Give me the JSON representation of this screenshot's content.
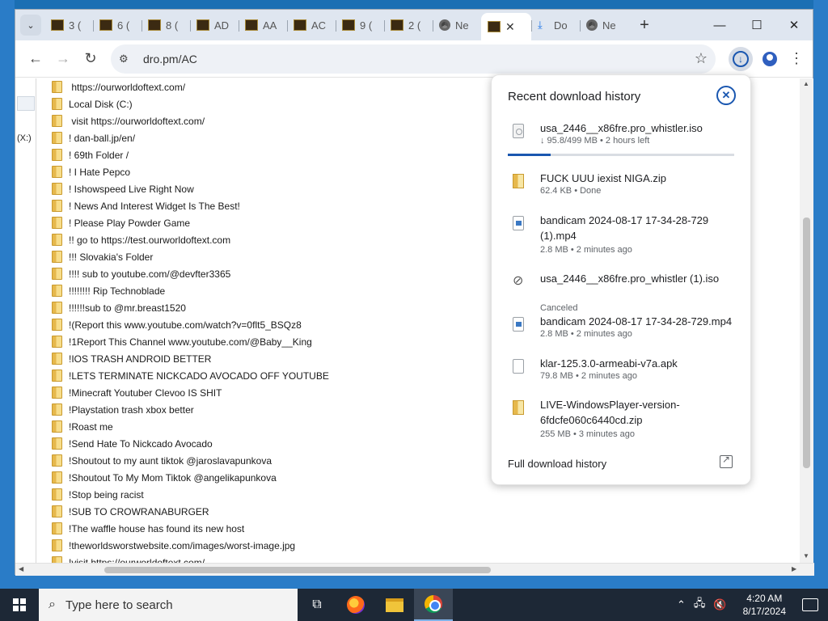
{
  "browser": {
    "tabs": [
      {
        "title": "3 (",
        "icon": "image-thumb-icon"
      },
      {
        "title": "6 (",
        "icon": "image-thumb-icon"
      },
      {
        "title": "8 (",
        "icon": "image-thumb-icon"
      },
      {
        "title": "AD",
        "icon": "image-thumb-icon"
      },
      {
        "title": "AA",
        "icon": "image-thumb-icon"
      },
      {
        "title": "AC",
        "icon": "image-thumb-icon"
      },
      {
        "title": "9 (",
        "icon": "image-thumb-icon"
      },
      {
        "title": "2 (",
        "icon": "image-thumb-icon"
      },
      {
        "title": "Ne",
        "icon": "chrome-icon"
      },
      {
        "title": "",
        "icon": "image-thumb-icon",
        "active": true
      },
      {
        "title": "Do",
        "icon": "download-icon"
      },
      {
        "title": "Ne",
        "icon": "chrome-icon"
      }
    ],
    "url": "dro.pm/AC"
  },
  "sidebar": {
    "drive_label": "(X:)"
  },
  "folders": [
    " https://ourworldoftext.com/",
    "Local Disk (C:)",
    " visit https://ourworldoftext.com/",
    "! dan-ball.jp/en/",
    "! 69th Folder /",
    "! I Hate Pepco",
    "! Ishowspeed Live Right Now",
    "! News And Interest Widget Is The Best!",
    "! Please Play Powder Game",
    "!! go to https://test.ourworldoftext.com",
    "!!! Slovakia's Folder",
    "!!!! sub to youtube.com/@devfter3365",
    "!!!!!!!! Rip Technoblade",
    "!!!!!!sub to @mr.breast1520",
    "!(Report this www.youtube.com/watch?v=0flt5_BSQz8",
    "!1Report This Channel www.youtube.com/@Baby__King",
    "!IOS TRASH ANDROID BETTER",
    "!LETS TERMINATE NICKCADO AVOCADO OFF YOUTUBE",
    "!Minecraft Youtuber Clevoo IS SHIT",
    "!Playstation trash xbox better",
    "!Roast me",
    "!Send Hate To Nickcado Avocado",
    "!Shoutout to my aunt tiktok @jaroslavapunkova",
    "!Shoutout To My Mom Tiktok @angelikapunkova",
    "!Stop being racist",
    "!SUB TO CROWRANABURGER",
    "!The waffle house has found its new host",
    "!theworldsworstwebsite.com/images/worst-image.jpg",
    "!visit https://ourworldoftext.com/"
  ],
  "downloads": {
    "title": "Recent download history",
    "items": [
      {
        "name": "usa_2446__x86fre.pro_whistler.iso",
        "meta": "↓ 95.8/499 MB • 2 hours left",
        "icon": "iso-file-icon",
        "progress": 0.19
      },
      {
        "name": "FUCK UUU iexist NIGA.zip",
        "meta": "62.4 KB • Done",
        "icon": "zip-file-icon"
      },
      {
        "name": "bandicam 2024-08-17 17-34-28-729 (1).mp4",
        "meta": "2.8 MB • 2 minutes ago",
        "icon": "video-file-icon"
      },
      {
        "name": "usa_2446__x86fre.pro_whistler (1).iso",
        "meta": "Canceled",
        "icon": "cancelled-download-icon"
      },
      {
        "name": "bandicam 2024-08-17 17-34-28-729.mp4",
        "meta": "2.8 MB • 2 minutes ago",
        "icon": "video-file-icon"
      },
      {
        "name": "klar-125.3.0-armeabi-v7a.apk",
        "meta": "79.8 MB • 2 minutes ago",
        "icon": "file-icon"
      },
      {
        "name": "LIVE-WindowsPlayer-version-6fdcfe060c6440cd.zip",
        "meta": "255 MB • 3 minutes ago",
        "icon": "zip-file-icon"
      }
    ],
    "footer": "Full download history"
  },
  "taskbar": {
    "search_placeholder": "Type here to search",
    "time": "4:20 AM",
    "date": "8/17/2024"
  }
}
